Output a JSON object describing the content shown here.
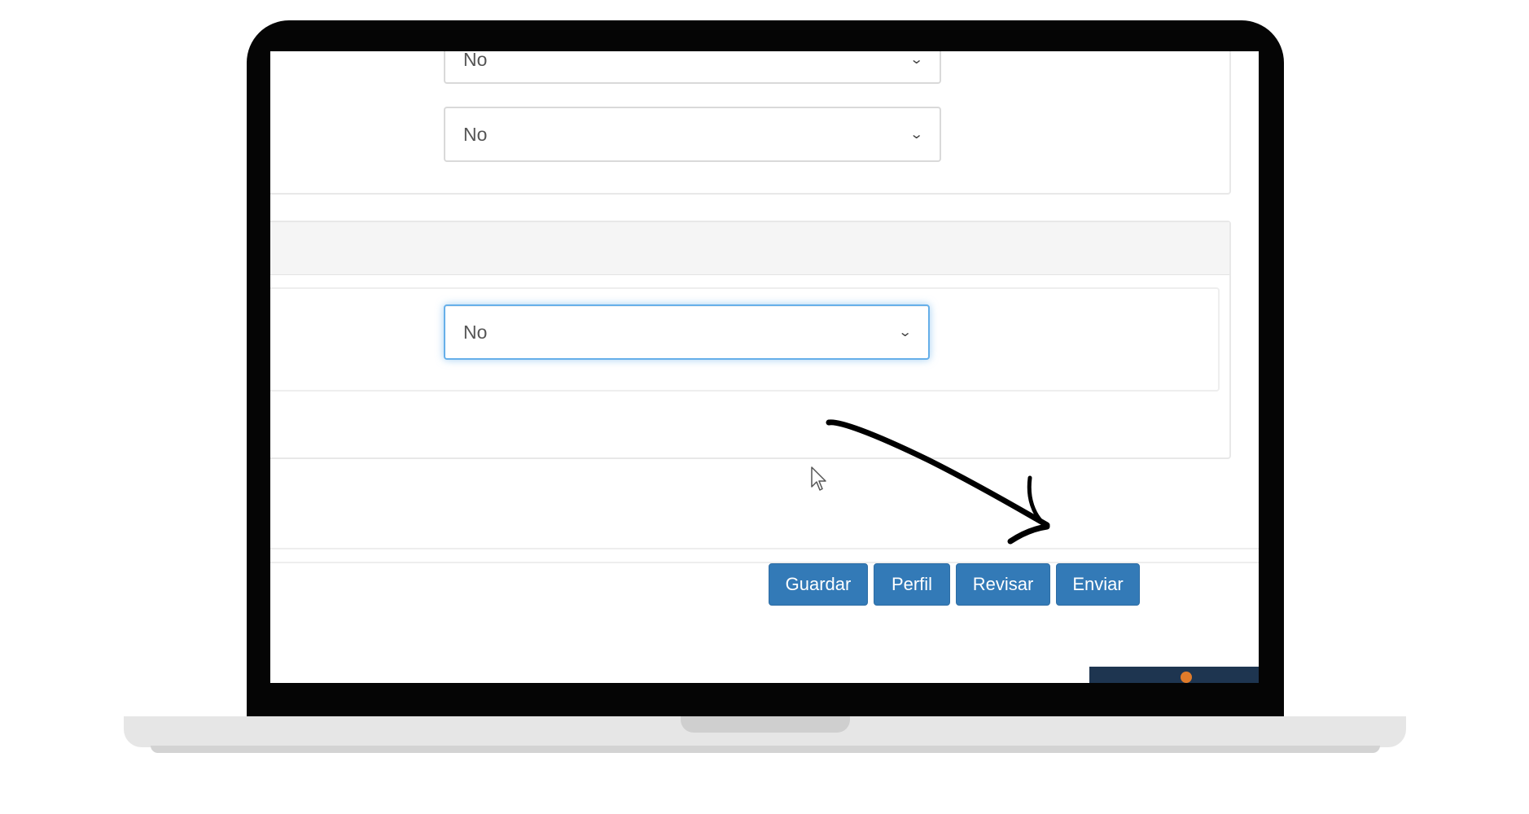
{
  "form": {
    "selects": [
      {
        "value": "No"
      },
      {
        "value": "No"
      },
      {
        "value": "No"
      }
    ]
  },
  "actions": {
    "guardar": "Guardar",
    "perfil": "Perfil",
    "revisar": "Revisar",
    "enviar": "Enviar"
  },
  "colors": {
    "button_primary": "#337ab7",
    "focus_ring": "#66afe9"
  },
  "icons": {
    "select_arrow": "chevron-down-icon",
    "pointer": "mouse-cursor-icon",
    "annotation": "hand-drawn-arrow"
  }
}
